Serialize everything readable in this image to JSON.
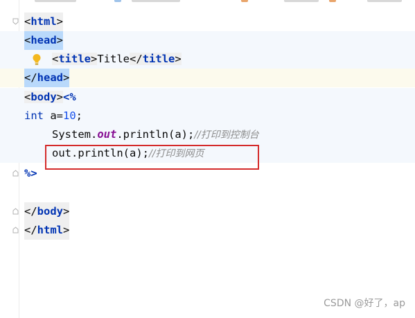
{
  "editor": {
    "lines": {
      "html_open": {
        "tag": "html"
      },
      "head_open": {
        "tag": "head"
      },
      "title": {
        "tag": "title",
        "text": "Title"
      },
      "head_close": {
        "tag": "head"
      },
      "body_open": {
        "tag": "body",
        "scriptlet": "<%"
      },
      "int_decl": {
        "keyword": "int",
        "name": " a=",
        "value": "10",
        "end": ";"
      },
      "system_println": {
        "prefix": "System.",
        "field": "out",
        "call": ".println(a);",
        "comment": "//打印到控制台"
      },
      "out_println": {
        "call": "out.println(a);",
        "comment": "//打印到网页"
      },
      "scriptlet_close": {
        "text": "%>"
      },
      "body_close": {
        "tag": "body"
      },
      "html_close": {
        "tag": "html"
      }
    }
  },
  "watermark": "CSDN @好了，ap",
  "colors": {
    "tag_name": "#0033b3",
    "field": "#871094",
    "number": "#1750eb",
    "comment": "#8c8c8c",
    "highlight_box": "#d42a2a",
    "tag_selected_bg": "#b9d9fb"
  },
  "icons": {
    "bulb": "lightbulb-icon",
    "fold": "fold-marker-icon"
  }
}
